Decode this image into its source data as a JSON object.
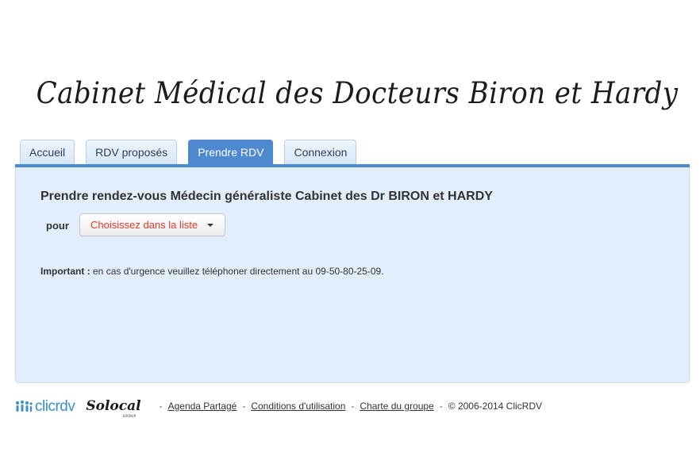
{
  "header": {
    "title": "Cabinet Médical des Docteurs Biron et Hardy"
  },
  "tabs": [
    {
      "label": "Accueil",
      "active": false
    },
    {
      "label": "RDV proposés",
      "active": false
    },
    {
      "label": "Prendre RDV",
      "active": true
    },
    {
      "label": "Connexion",
      "active": false
    }
  ],
  "main": {
    "title": "Prendre rendez-vous Médecin généraliste Cabinet des Dr BIRON et HARDY",
    "pour_label": "pour",
    "select_value": "Choisissez dans la liste",
    "notice_bold": "Important :",
    "notice_text": " en cas d'urgence veuillez téléphoner directement au 09-50-80-25-09."
  },
  "footer": {
    "clicrdv_logo": "clicrdv",
    "solocal_logo": "Solocal",
    "solocal_sub": "GROUP",
    "sep": "-",
    "links": [
      "Agenda Partagé",
      "Conditions d'utilisation",
      "Charte du groupe"
    ],
    "copyright": "© 2006-2014 ClicRDV"
  },
  "colors": {
    "accent": "#4e89cf",
    "panel_bg": "#e2eefb",
    "select_text": "#e03b2a",
    "clicrdv_blue": "#3a8fc4"
  },
  "icons": {
    "select_caret": "caret-down-icon",
    "clicrdv_people": "people-icon"
  }
}
